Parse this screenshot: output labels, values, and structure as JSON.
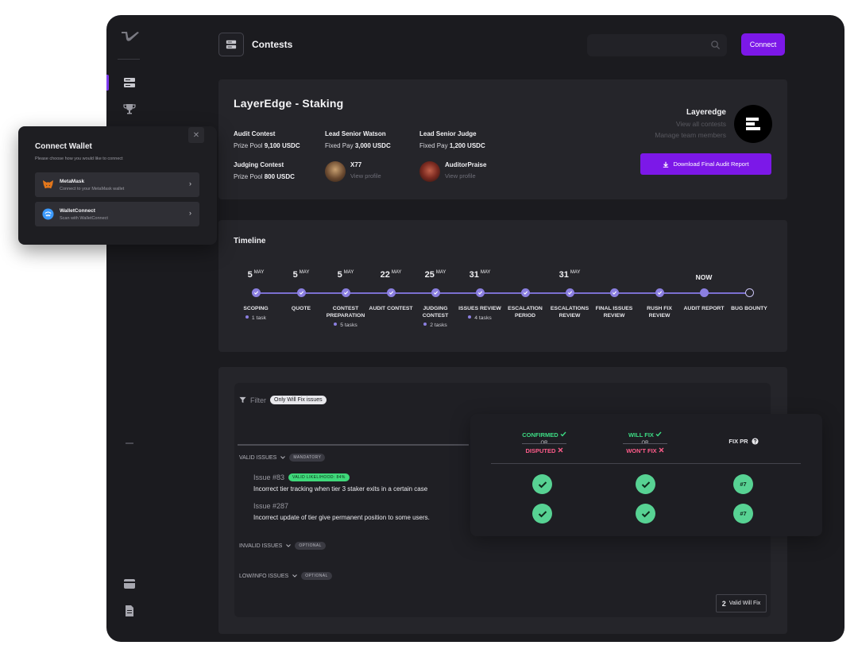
{
  "header": {
    "title": "Contests",
    "connect_label": "Connect"
  },
  "contest": {
    "title": "LayerEdge - Staking",
    "audit_contest_label": "Audit Contest",
    "audit_prize_label": "Prize Pool",
    "audit_prize_value": "9,100 USDC",
    "judging_contest_label": "Judging Contest",
    "judging_prize_label": "Prize Pool",
    "judging_prize_value": "800 USDC",
    "lead_watson_label": "Lead Senior Watson",
    "lead_watson_pay_label": "Fixed Pay",
    "lead_watson_pay_value": "3,000 USDC",
    "lead_watson_name": "X77",
    "lead_watson_link": "View profile",
    "lead_judge_label": "Lead Senior Judge",
    "lead_judge_pay_label": "Fixed Pay",
    "lead_judge_pay_value": "1,200 USDC",
    "lead_judge_name": "AuditorPraise",
    "lead_judge_link": "View profile",
    "org_name": "Layeredge",
    "org_view_all": "View all contests",
    "org_manage": "Manage team members",
    "download_label": "Download Final Audit Report"
  },
  "timeline": {
    "title": "Timeline",
    "dates": [
      {
        "day": "5",
        "month": "MAY"
      },
      {
        "day": "5",
        "month": "MAY"
      },
      {
        "day": "5",
        "month": "MAY"
      },
      {
        "day": "22",
        "month": "MAY"
      },
      {
        "day": "25",
        "month": "MAY"
      },
      {
        "day": "31",
        "month": "MAY"
      },
      {
        "day": "31",
        "month": "MAY"
      }
    ],
    "now_label": "NOW",
    "steps": [
      {
        "label": "SCOPING",
        "task": "1 task"
      },
      {
        "label": "QUOTE",
        "task": ""
      },
      {
        "label": "CONTEST PREPARATION",
        "task": "5 tasks"
      },
      {
        "label": "AUDIT CONTEST",
        "task": ""
      },
      {
        "label": "JUDGING CONTEST",
        "task": "2 tasks"
      },
      {
        "label": "ISSUES REVIEW",
        "task": "4 tasks"
      },
      {
        "label": "ESCALATION PERIOD",
        "task": ""
      },
      {
        "label": "ESCALATIONS REVIEW",
        "task": ""
      },
      {
        "label": "FINAL ISSUES REVIEW",
        "task": ""
      },
      {
        "label": "RUSH FIX REVIEW",
        "task": ""
      },
      {
        "label": "AUDIT REPORT",
        "task": ""
      },
      {
        "label": "BUG BOUNTY",
        "task": ""
      }
    ]
  },
  "issues": {
    "filter_label": "Filter",
    "filter_chip": "Only Will Fix issues",
    "valid_label": "VALID ISSUES",
    "valid_tag": "MANDATORY",
    "invalid_label": "INVALID ISSUES",
    "invalid_tag": "OPTIONAL",
    "low_label": "LOW/INFO ISSUES",
    "low_tag": "OPTIONAL",
    "items": [
      {
        "number": "Issue #83",
        "badge": "VALID LIKELIHOOD: 84%",
        "title": "Incorrect tier tracking when tier 3 staker exits in a certain case"
      },
      {
        "number": "Issue #287",
        "badge": "",
        "title": "Incorrect update of tier give permanent position to some users."
      }
    ],
    "valid_will_fix_count": "2",
    "valid_will_fix_label": "Valid Will Fix"
  },
  "status_card": {
    "confirmed": "CONFIRMED",
    "or1": "OR",
    "disputed": "DISPUTED",
    "will_fix": "WILL FIX",
    "or2": "OR",
    "wont_fix": "WON'T FIX",
    "fix_pr": "FIX PR",
    "rows": [
      {
        "pr": "#7"
      },
      {
        "pr": "#7"
      }
    ]
  },
  "wallet_modal": {
    "title": "Connect Wallet",
    "subtitle": "Please choose how you would like to connect",
    "options": [
      {
        "name": "MetaMask",
        "desc": "Connect to your MetaMask wallet"
      },
      {
        "name": "WalletConnect",
        "desc": "Scan with WalletConnect"
      }
    ]
  },
  "colors": {
    "accent": "#7c18e8",
    "success": "#57d293",
    "danger": "#ff5c8a",
    "timeline": "#8b7fe0"
  }
}
